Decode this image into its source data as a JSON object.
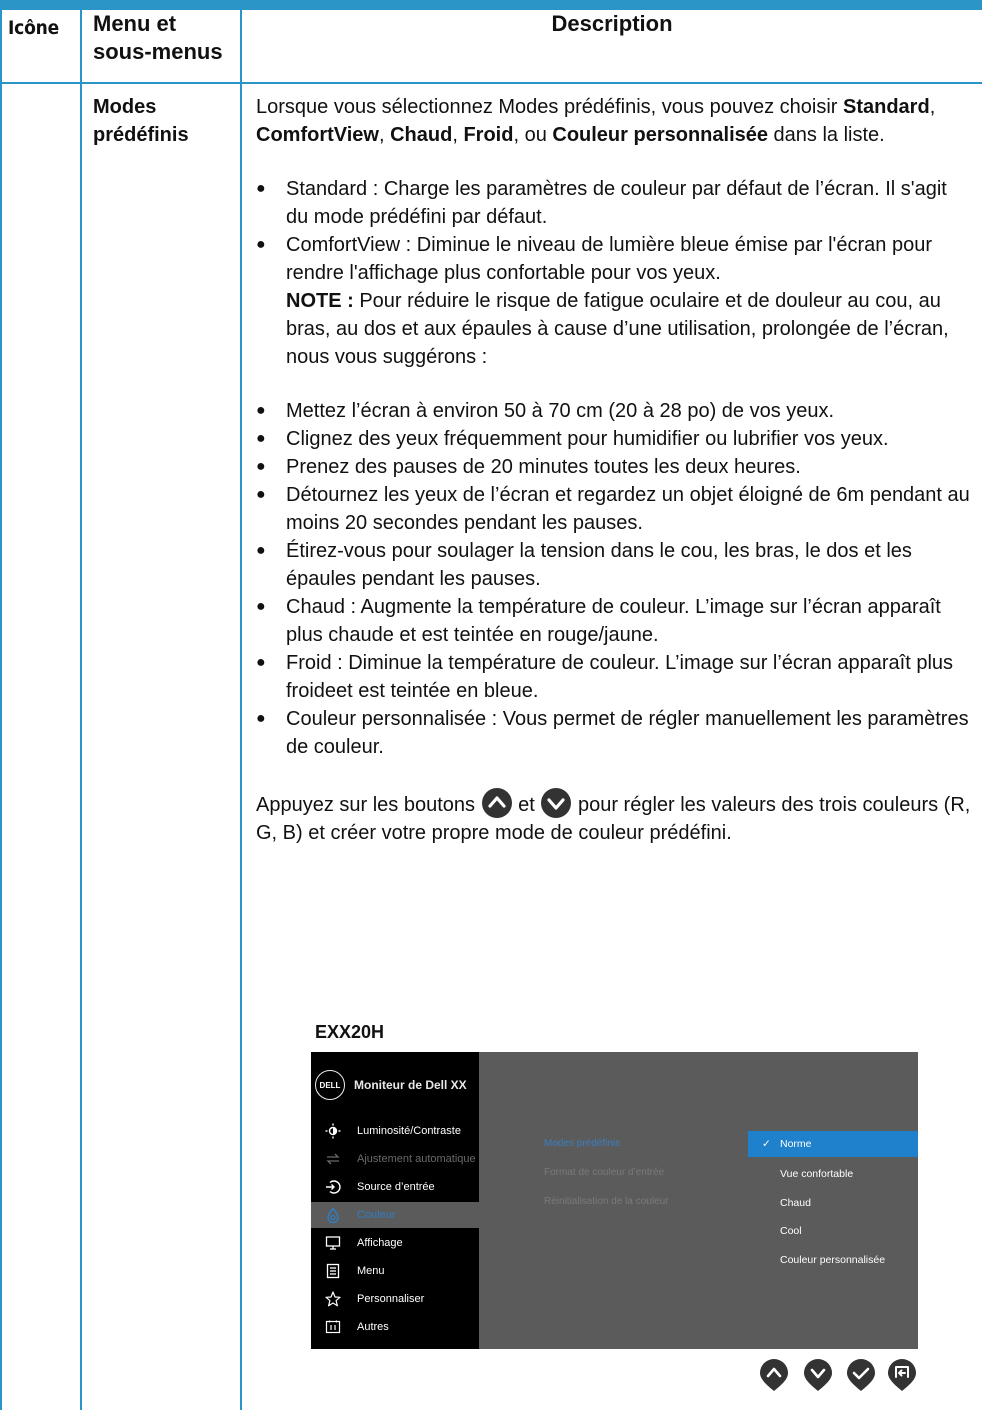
{
  "colors": {
    "accent": "#2c95c8",
    "osd_panel": "#5b5b5b",
    "osd_highlight": "#1f80cc"
  },
  "header": {
    "icon_col": "Icône",
    "menu_col_line1": "Menu et",
    "menu_col_line2": "sous-menus",
    "desc_col": "Description"
  },
  "row": {
    "label_line1": "Modes",
    "label_line2": "prédéfinis",
    "intro": {
      "t1": "Lorsque vous sélectionnez Modes prédéfinis, vous pouvez choisir ",
      "b1": "Standard",
      "s1": ", ",
      "b2": "ComfortView",
      "s2": ", ",
      "b3": "Chaud",
      "s3": ", ",
      "b4": "Froid",
      "s4": ", ou ",
      "b5": "Couleur personnalisée",
      "t2": " dans la liste."
    },
    "bullets_a": [
      "Standard : Charge les paramètres de couleur par défaut de l’écran. Il s'agit du mode prédéfini par défaut.",
      "ComfortView : Diminue le niveau de lumière bleue émise par l'écran pour rendre l'affichage plus confortable pour vos yeux."
    ],
    "note_label": "NOTE :",
    "note_text": " Pour réduire le risque de fatigue oculaire et de douleur au cou, au bras, au dos et aux épaules à cause d’une utilisation, prolongée de l’écran, nous vous suggérons :",
    "bullets_b": [
      "Mettez l’écran à environ 50 à 70 cm (20 à 28 po) de vos yeux.",
      "Clignez des yeux fréquemment pour humidifier ou lubrifier vos yeux.",
      "Prenez des pauses de 20 minutes toutes les deux heures.",
      "Détournez les yeux de l’écran et regardez un objet éloigné de 6m pendant au moins 20 secondes pendant les pauses.",
      "Étirez-vous pour soulager la tension dans le cou, les bras, le dos et les épaules pendant les pauses.",
      "Chaud : Augmente la température de couleur. L’image sur l’écran apparaît plus chaude et est teintée en rouge/jaune.",
      "Froid : Diminue la température de couleur. L’image sur l’écran apparaît plus froideet est teintée en bleue.",
      "Couleur personnalisée : Vous permet de régler manuellement les paramètres de couleur."
    ],
    "buttons_p1": "Appuyez sur les boutons ",
    "buttons_p2": " et ",
    "buttons_p3": " pour régler les valeurs des trois couleurs (R, G, B) et créer votre propre mode de couleur prédéfini."
  },
  "osd": {
    "model": "EXX20H",
    "logo_text": "DELL",
    "title": "Moniteur de Dell XX",
    "menu": [
      {
        "label": "Luminosité/Contraste",
        "icon": "brightness-icon",
        "state": "normal"
      },
      {
        "label": "Ajustement automatique",
        "icon": "auto-adjust-icon",
        "state": "dim"
      },
      {
        "label": "Source d’entrée",
        "icon": "input-source-icon",
        "state": "normal"
      },
      {
        "label": "Couleur",
        "icon": "color-icon",
        "state": "selected"
      },
      {
        "label": "Affichage",
        "icon": "display-icon",
        "state": "normal"
      },
      {
        "label": "Menu",
        "icon": "menu-icon",
        "state": "normal"
      },
      {
        "label": "Personnaliser",
        "icon": "star-icon",
        "state": "normal"
      },
      {
        "label": "Autres",
        "icon": "others-icon",
        "state": "normal"
      }
    ],
    "submenu": [
      "Modes prédéfinis",
      "Format de couleur d’entrée",
      "Réinitialisation de la couleur"
    ],
    "options": [
      "Norme",
      "Vue confortable",
      "Chaud",
      "Cool",
      "Couleur personnalisée"
    ],
    "selected_option_index": 0,
    "nav_buttons": [
      "up-arrow-icon",
      "down-arrow-icon",
      "check-icon",
      "back-icon"
    ]
  }
}
